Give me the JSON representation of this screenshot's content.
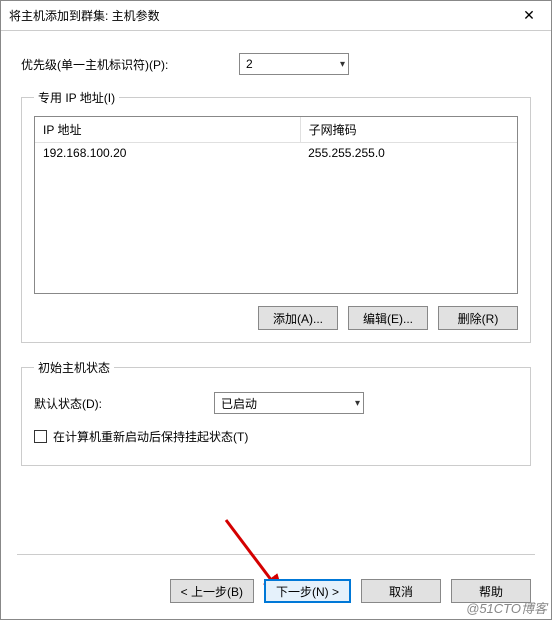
{
  "title": "将主机添加到群集: 主机参数",
  "close_glyph": "✕",
  "priority": {
    "label": "优先级(单一主机标识符)(P):",
    "value": "2"
  },
  "ip_group": {
    "legend": "专用 IP 地址(I)",
    "col_ip": "IP 地址",
    "col_mask": "子网掩码",
    "row_ip": "192.168.100.20",
    "row_mask": "255.255.255.0",
    "add_btn": "添加(A)...",
    "edit_btn": "编辑(E)...",
    "remove_btn": "删除(R)"
  },
  "state_group": {
    "legend": "初始主机状态",
    "default_label": "默认状态(D):",
    "default_value": "已启动",
    "retain_label": "在计算机重新启动后保持挂起状态(T)"
  },
  "footer": {
    "back": "< 上一步(B)",
    "next": "下一步(N) >",
    "cancel": "取消",
    "help": "帮助"
  },
  "watermark": "@51CTO博客"
}
